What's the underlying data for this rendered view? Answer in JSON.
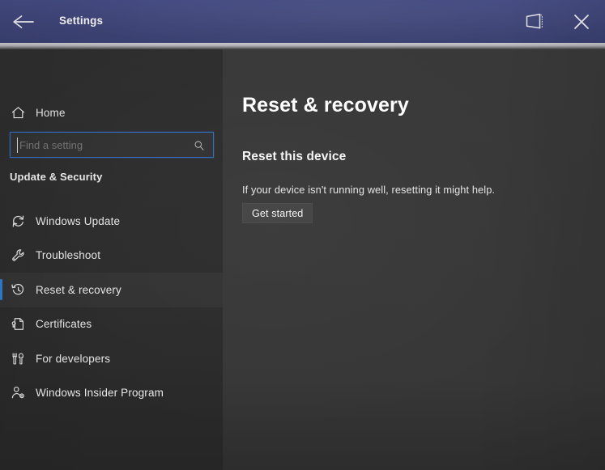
{
  "window": {
    "title": "Settings",
    "titlebar_color": "#3f4578",
    "back_icon": "back-arrow-icon",
    "restore_icon": "tablet-window-icon",
    "close_icon": "close-icon"
  },
  "sidebar": {
    "home": {
      "label": "Home",
      "icon": "home-icon"
    },
    "search": {
      "placeholder": "Find a setting",
      "value": "",
      "icon": "search-icon",
      "focus_border_color": "#2f6fc4"
    },
    "section_header": "Update & Security",
    "selection_color": "#2d7bd0",
    "items": [
      {
        "label": "Windows Update",
        "icon": "refresh-icon",
        "selected": false
      },
      {
        "label": "Troubleshoot",
        "icon": "wrench-icon",
        "selected": false
      },
      {
        "label": "Reset & recovery",
        "icon": "history-clock-icon",
        "selected": true
      },
      {
        "label": "Certificates",
        "icon": "certificate-document-icon",
        "selected": false
      },
      {
        "label": "For developers",
        "icon": "tools-icon",
        "selected": false
      },
      {
        "label": "Windows Insider Program",
        "icon": "person-badge-icon",
        "selected": false
      }
    ]
  },
  "main": {
    "page_title": "Reset & recovery",
    "group_title": "Reset this device",
    "group_description": "If your device isn't running well, resetting it might help.",
    "primary_button": "Get started"
  }
}
